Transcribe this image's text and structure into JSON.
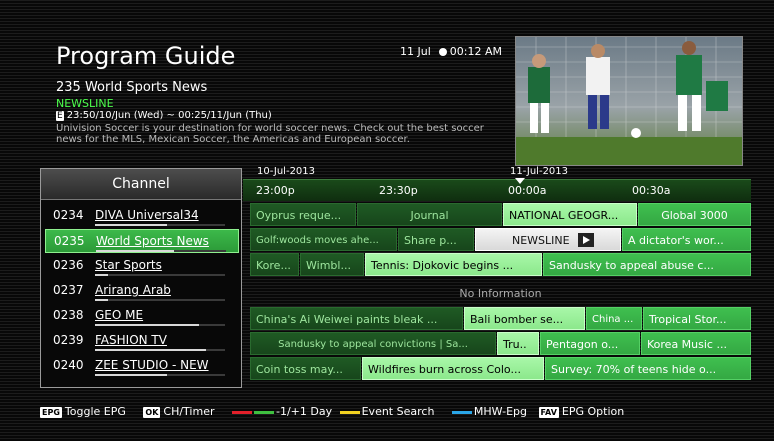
{
  "header": {
    "title": "Program Guide",
    "date": "11 Jul",
    "time": "00:12 AM"
  },
  "current": {
    "channel": "235  World Sports News",
    "program": "NEWSLINE",
    "schedule": "23:50/10/Jun (Wed) ~ 00:25/11/Jun (Thu)",
    "description": "Univision Soccer is your destination for world soccer news. Check out the best soccer news for the MLS, Mexican Soccer, the Americas and European soccer."
  },
  "timeline": {
    "date_left": "10-Jul-2013",
    "date_right": "11-Jul-2013",
    "slots": [
      "23:00p",
      "23:30p",
      "00:00a",
      "00:30a"
    ]
  },
  "channel_list": {
    "header": "Channel",
    "items": [
      {
        "num": "0234",
        "name": "DIVA Universal34",
        "progress": 0.55
      },
      {
        "num": "0235",
        "name": "World Sports News",
        "progress": 0.6
      },
      {
        "num": "0236",
        "name": "Star Sports",
        "progress": 0.1
      },
      {
        "num": "0237",
        "name": "Arirang Arab",
        "progress": 0.1
      },
      {
        "num": "0238",
        "name": "GEO ME",
        "progress": 0.8
      },
      {
        "num": "0239",
        "name": "FASHION TV",
        "progress": 0.85
      },
      {
        "num": "0240",
        "name": "ZEE STUDIO - NEW",
        "progress": 0.55
      }
    ]
  },
  "grid": {
    "rows": [
      [
        {
          "title": "Oyprus reque..."
        },
        {
          "title": "Journal"
        },
        {
          "title": "NATIONAL GEOGR..."
        },
        {
          "title": "Global 3000"
        }
      ],
      [
        {
          "title": "Golf:woods moves ahe..."
        },
        {
          "title": "Share p..."
        },
        {
          "title": "NEWSLINE"
        },
        {
          "title": "A dictator's wor..."
        }
      ],
      [
        {
          "title": "Kore..."
        },
        {
          "title": "Wimbl..."
        },
        {
          "title": "Tennis: Djokovic begins ..."
        },
        {
          "title": "Sandusky to appeal abuse c..."
        }
      ],
      [
        {
          "title": "No Information"
        }
      ],
      [
        {
          "title": "China's Ai Weiwei paints bleak ..."
        },
        {
          "title": "Bali bomber se..."
        },
        {
          "title": "China ..."
        },
        {
          "title": "Tropical Stor..."
        }
      ],
      [
        {
          "title": "Sandusky to appeal convictions | Sa..."
        },
        {
          "title": "Tru.."
        },
        {
          "title": "Pentagon o..."
        },
        {
          "title": "Korea Music ..."
        }
      ],
      [
        {
          "title": "Coin toss may..."
        },
        {
          "title": "Wildfires burn across Colo..."
        },
        {
          "title": "Survey: 70% of teens hide o..."
        }
      ]
    ]
  },
  "footer": {
    "epg_key": "EPG",
    "epg_label": "Toggle EPG",
    "ok_key": "OK",
    "ok_label": "CH/Timer",
    "day_label": "-1/+1 Day",
    "search_label": "Event Search",
    "mhw_label": "MHW-Epg",
    "fav_key": "FAV",
    "fav_label": "EPG Option"
  },
  "colors": {
    "red": "#e3202a",
    "green": "#3fc040",
    "yellow": "#f0d020",
    "blue": "#2aa6e8"
  }
}
